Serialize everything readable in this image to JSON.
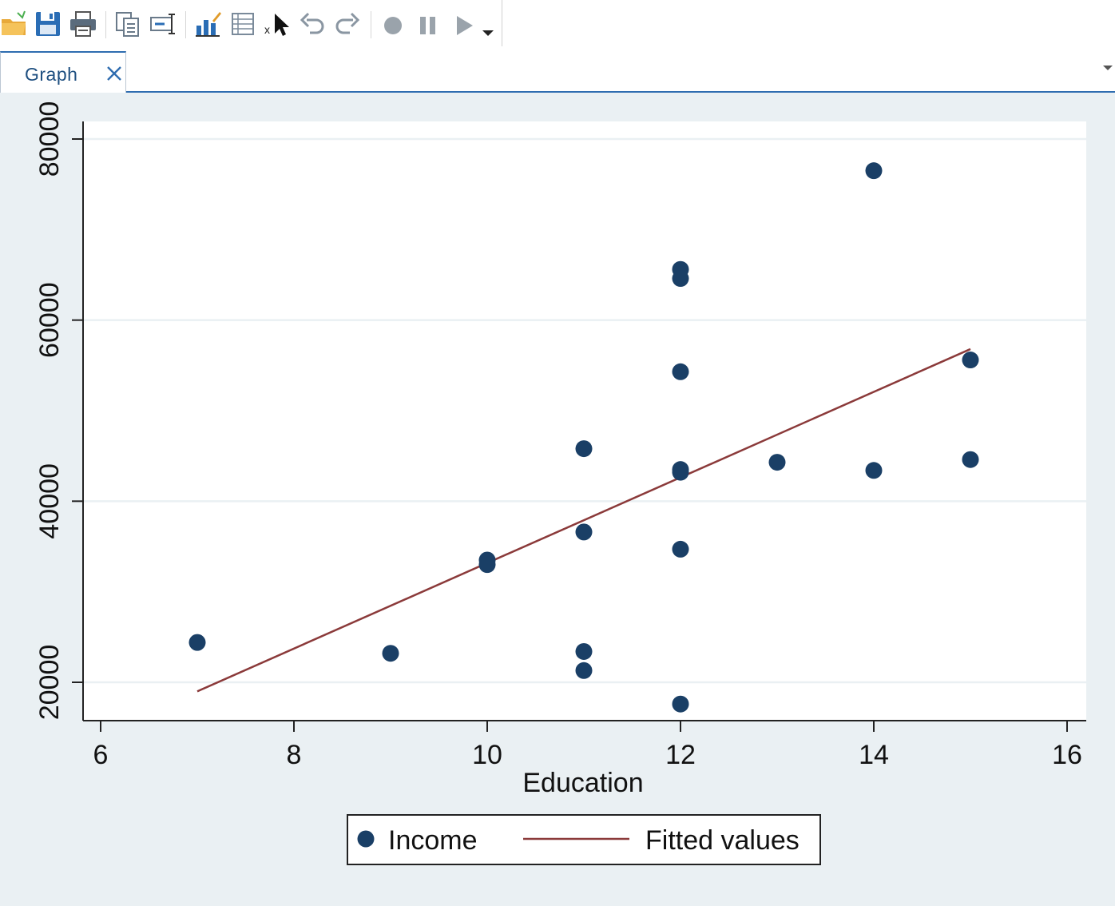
{
  "toolbar": {
    "icons": [
      "open-folder-icon",
      "save-icon",
      "print-icon",
      "copy-graph-icon",
      "rename-icon",
      "graph-editor-icon",
      "data-browser-icon",
      "pointer-select-icon",
      "undo-icon",
      "redo-icon",
      "record-icon",
      "pause-icon",
      "play-icon",
      "dropdown-arrow-icon"
    ]
  },
  "tabs": [
    {
      "label": "Graph",
      "active": true
    }
  ],
  "colors": {
    "marker": "#1a3f66",
    "fit_line": "#8b3a3a",
    "plot_bg": "#ffffff",
    "outer_bg": "#eaf0f3",
    "grid": "#eaf0f3",
    "tab_accent": "#2f6db0"
  },
  "chart_data": {
    "type": "scatter",
    "xlabel": "Education",
    "ylabel": "",
    "xlim": [
      6,
      16
    ],
    "ylim": [
      16000,
      82000
    ],
    "xticks": [
      6,
      8,
      10,
      12,
      14,
      16
    ],
    "yticks": [
      20000,
      40000,
      60000,
      80000
    ],
    "grid": "horizontal",
    "legend_position": "bottom",
    "legend": [
      {
        "label": "Income",
        "kind": "marker"
      },
      {
        "label": "Fitted values",
        "kind": "line"
      }
    ],
    "series": [
      {
        "name": "Income",
        "kind": "scatter",
        "points": [
          [
            7,
            24400
          ],
          [
            9,
            23200
          ],
          [
            10,
            33500
          ],
          [
            10,
            33000
          ],
          [
            11,
            45800
          ],
          [
            11,
            36600
          ],
          [
            11,
            23400
          ],
          [
            11,
            21300
          ],
          [
            12,
            65600
          ],
          [
            12,
            64600
          ],
          [
            12,
            54300
          ],
          [
            12,
            43500
          ],
          [
            12,
            43200
          ],
          [
            12,
            34700
          ],
          [
            12,
            17600
          ],
          [
            13,
            44300
          ],
          [
            14,
            76500
          ],
          [
            14,
            43400
          ],
          [
            15,
            55600
          ],
          [
            15,
            44600
          ]
        ]
      },
      {
        "name": "Fitted values",
        "kind": "line",
        "points": [
          [
            7,
            19000
          ],
          [
            15,
            56800
          ]
        ]
      }
    ]
  }
}
